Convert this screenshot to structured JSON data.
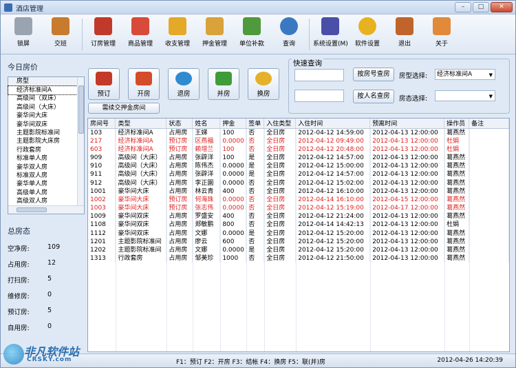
{
  "window": {
    "title": "酒店管理",
    "minimize": "–",
    "maximize": "□",
    "close": "✕"
  },
  "toolbar": [
    {
      "name": "lock",
      "label": "锁屏",
      "color": "#9aa4b0"
    },
    {
      "name": "shift",
      "label": "交班",
      "color": "#c87b2e"
    },
    {
      "name": "booking-mgmt",
      "label": "订房管理",
      "color": "#c0392b"
    },
    {
      "name": "goods-mgmt",
      "label": "商品管理",
      "color": "#d84a3a"
    },
    {
      "name": "payment-mgmt",
      "label": "收支管理",
      "color": "#e5a92a"
    },
    {
      "name": "deposit-mgmt",
      "label": "押金管理",
      "color": "#d9a23b"
    },
    {
      "name": "unit-pay",
      "label": "单位补款",
      "color": "#4f9a3c"
    },
    {
      "name": "query",
      "label": "查询",
      "color": "#3a79c2"
    },
    {
      "name": "system-settings",
      "label": "系统设置(M)",
      "color": "#4a4fa8"
    },
    {
      "name": "software-settings",
      "label": "软件设置",
      "color": "#e6b220"
    },
    {
      "name": "exit",
      "label": "退出",
      "color": "#c0642b"
    },
    {
      "name": "about",
      "label": "关于",
      "color": "#e08a3a"
    }
  ],
  "left": {
    "rate_title": "今日房价",
    "list_header": "房型",
    "room_types": [
      "经济标准间A",
      "高级间（双床）",
      "高级间（大床）",
      "豪华间大床",
      "豪华间双床",
      "主题影院标准间",
      "主题影院大床房",
      "行政套房",
      "标准单人房",
      "豪华双人房",
      "标准双人房",
      "豪华单人房",
      "高级单人房",
      "高级双人房"
    ],
    "stats_title": "总房态",
    "stats": [
      {
        "label": "空净房:",
        "value": "109"
      },
      {
        "label": "占用房:",
        "value": "12"
      },
      {
        "label": "打扫房:",
        "value": "5"
      },
      {
        "label": "维修房:",
        "value": "0"
      },
      {
        "label": "预订房:",
        "value": "5"
      },
      {
        "label": "自用房:",
        "value": "0"
      }
    ]
  },
  "actions": [
    {
      "name": "book",
      "label": "预订",
      "color": "#c43a2a"
    },
    {
      "name": "open",
      "label": "开房",
      "color": "#d44d2a"
    },
    {
      "name": "checkout",
      "label": "退房",
      "color": "#2e8bd0"
    },
    {
      "name": "merge",
      "label": "并房",
      "color": "#3f9c3a"
    },
    {
      "name": "change",
      "label": "换房",
      "color": "#e3b22a"
    }
  ],
  "continue_deposit": "需续交押金房间",
  "query": {
    "title": "快速查询",
    "by_room_button": "按房号查房",
    "by_name_button": "按人名查房",
    "room_type_label": "房型选择:",
    "room_type_value": "经济标准间A",
    "room_status_label": "房态选择:",
    "room_status_value": ""
  },
  "table": {
    "columns": [
      "房间号",
      "类型",
      "状态",
      "姓名",
      "押金",
      "签单",
      "入住类型",
      "入住时间",
      "预离时间",
      "操作员",
      "备注"
    ],
    "rows": [
      {
        "red": false,
        "cells": [
          "103",
          "经济标准间A",
          "占用房",
          "王娣",
          "100",
          "否",
          "全日房",
          "2012-04-12 14:59:00",
          "2012-04-13 12:00:00",
          "葛燕然",
          ""
        ]
      },
      {
        "red": true,
        "cells": [
          "217",
          "经济标准间A",
          "预订房",
          "区燕福",
          "0.0000",
          "否",
          "全日房",
          "2012-04-12 09:49:00",
          "2012-04-13 12:00:00",
          "杜娟",
          ""
        ]
      },
      {
        "red": true,
        "cells": [
          "603",
          "经济标准间A",
          "预订房",
          "赖增兰",
          "100",
          "否",
          "全日房",
          "2012-04-12 20:48:00",
          "2012-04-13 12:00:00",
          "杜娟",
          ""
        ]
      },
      {
        "red": false,
        "cells": [
          "909",
          "高级间（大床）",
          "占用房",
          "张辟洋",
          "100",
          "是",
          "全日房",
          "2012-04-12 14:57:00",
          "2012-04-13 12:00:00",
          "葛燕然",
          ""
        ]
      },
      {
        "red": false,
        "cells": [
          "910",
          "高级间（大床）",
          "占用房",
          "陈伟杰",
          "0.0000",
          "是",
          "全日房",
          "2012-04-12 15:00:00",
          "2012-04-13 12:00:00",
          "葛燕然",
          ""
        ]
      },
      {
        "red": false,
        "cells": [
          "911",
          "高级间（大床）",
          "占用房",
          "张辟洋",
          "0.0000",
          "是",
          "全日房",
          "2012-04-12 14:57:00",
          "2012-04-13 12:00:00",
          "葛燕然",
          ""
        ]
      },
      {
        "red": false,
        "cells": [
          "912",
          "高级间（大床）",
          "占用房",
          "李正園",
          "0.0000",
          "否",
          "全日房",
          "2012-04-12 15:02:00",
          "2012-04-13 12:00:00",
          "葛燕然",
          ""
        ]
      },
      {
        "red": false,
        "cells": [
          "1001",
          "豪华间大床",
          "占用房",
          "林云青",
          "400",
          "否",
          "全日房",
          "2012-04-12 16:10:00",
          "2012-04-13 12:00:00",
          "葛燕然",
          ""
        ]
      },
      {
        "red": true,
        "cells": [
          "1002",
          "豪华间大床",
          "预订房",
          "何海珠",
          "0.0000",
          "否",
          "全日房",
          "2012-04-14 16:10:00",
          "2012-04-15 12:00:00",
          "葛燕然",
          ""
        ]
      },
      {
        "red": true,
        "cells": [
          "1003",
          "豪华间大床",
          "预订房",
          "张志伟",
          "0.0000",
          "否",
          "全日房",
          "2012-04-12 15:19:00",
          "2012-04-17 12:00:00",
          "葛燕然",
          ""
        ]
      },
      {
        "red": false,
        "cells": [
          "1009",
          "豪华间双床",
          "占用房",
          "罗盛安",
          "400",
          "否",
          "全日房",
          "2012-04-12 21:24:00",
          "2012-04-13 12:00:00",
          "葛燕然",
          ""
        ]
      },
      {
        "red": false,
        "cells": [
          "1108",
          "豪华间双床",
          "占用房",
          "郑敏鹏",
          "800",
          "否",
          "全日房",
          "2012-04-14 14:42:13",
          "2012-04-13 12:00:00",
          "杜娟",
          ""
        ]
      },
      {
        "red": false,
        "cells": [
          "1112",
          "豪华间双床",
          "占用房",
          "文娜",
          "0.0000",
          "是",
          "全日房",
          "2012-04-12 15:20:00",
          "2012-04-13 12:00:00",
          "葛燕然",
          ""
        ]
      },
      {
        "red": false,
        "cells": [
          "1201",
          "主题影院标准间",
          "占用房",
          "廖云",
          "600",
          "否",
          "全日房",
          "2012-04-12 15:20:00",
          "2012-04-13 12:00:00",
          "葛燕然",
          ""
        ]
      },
      {
        "red": false,
        "cells": [
          "1202",
          "主题影院标准间",
          "占用房",
          "文娜",
          "0.0000",
          "是",
          "全日房",
          "2012-04-12 15:20:00",
          "2012-04-13 12:00:00",
          "葛燕然",
          ""
        ]
      },
      {
        "red": false,
        "cells": [
          "1313",
          "行政套房",
          "占用房",
          "邹美珍",
          "1000",
          "否",
          "全日房",
          "2012-04-12 21:50:00",
          "2012-04-13 12:00:00",
          "葛燕然",
          ""
        ]
      }
    ]
  },
  "status": {
    "hint": "F1：预订 F2：开房 F3：结帐 F4：换房 F5：联(并)房",
    "time": "2012-04-26 14:20:39"
  },
  "watermark": {
    "text": "非凡软件站",
    "sub": "CRSKY.com"
  }
}
